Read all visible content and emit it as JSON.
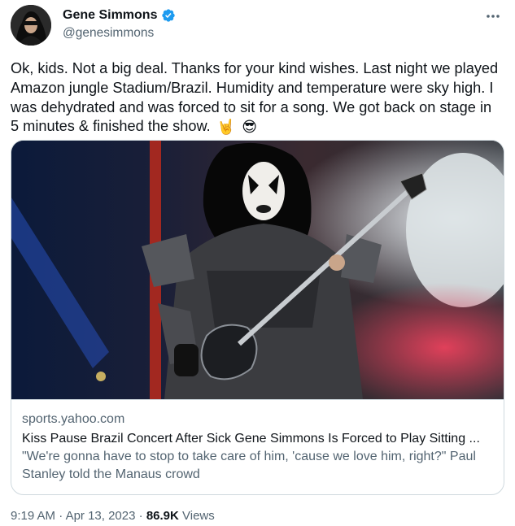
{
  "author": {
    "display_name": "Gene Simmons",
    "handle": "@genesimmons",
    "verified": true,
    "verified_color": "#1d9bf0"
  },
  "tweet": {
    "text": "Ok, kids. Not a big deal. Thanks for your kind wishes. Last night we played Amazon jungle Stadium/Brazil. Humidity and temperature were sky high. I was dehydrated and was forced to sit for a song. We got back on stage in 5 minutes & finished the show.",
    "emojis": [
      "🤘",
      "😎"
    ]
  },
  "card": {
    "domain": "sports.yahoo.com",
    "title": "Kiss Pause Brazil Concert After Sick Gene Simmons Is Forced to Play Sitting ...",
    "description": "\"We're gonna have to stop to take care of him, 'cause we love him, right?\" Paul Stanley told the Manaus crowd"
  },
  "meta": {
    "time": "9:19 AM",
    "separator": "·",
    "date": "Apr 13, 2023",
    "views_count": "86.9K",
    "views_label": "Views"
  },
  "icons": {
    "more": "more-horizontal-icon",
    "verified": "verified-badge-icon"
  }
}
